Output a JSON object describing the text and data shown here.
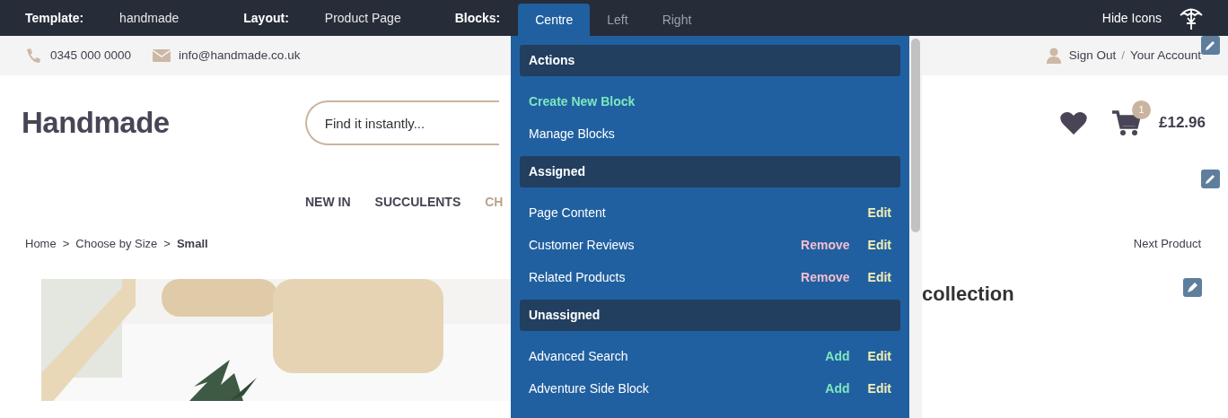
{
  "toolbar": {
    "fields": [
      {
        "label": "Template:",
        "value": "handmade"
      },
      {
        "label": "Layout:",
        "value": "Product Page"
      }
    ],
    "blocks_label": "Blocks:",
    "tabs": [
      {
        "label": "Centre",
        "selected": true
      },
      {
        "label": "Left",
        "selected": false
      },
      {
        "label": "Right",
        "selected": false
      }
    ],
    "hide_icons": "Hide Icons"
  },
  "contact_bar": {
    "phone": "0345 000 0000",
    "email": "info@handmade.co.uk",
    "sign_out": "Sign Out",
    "separator": "/",
    "account": "Your Account"
  },
  "header": {
    "logo": "Handmade",
    "search": {
      "placeholder": "Find it instantly..."
    },
    "cart_count": "1",
    "cart_total": "£12.96"
  },
  "nav": [
    {
      "label": "NEW IN",
      "selected": false
    },
    {
      "label": "SUCCULENTS",
      "selected": false
    },
    {
      "label": "CH",
      "selected": true
    }
  ],
  "breadcrumb": {
    "items": [
      {
        "label": "Home",
        "current": false
      },
      {
        "label": "Choose by Size",
        "current": false
      },
      {
        "label": "Small",
        "current": true
      }
    ],
    "separators": [
      ">",
      ">"
    ]
  },
  "next_product": "Next Product",
  "product_title": "collection",
  "blocks_panel": {
    "sections": [
      {
        "title": "Actions",
        "items": [
          {
            "label": "Create New Block",
            "highlighted": true
          },
          {
            "label": "Manage Blocks",
            "highlighted": false
          }
        ]
      },
      {
        "title": "Assigned",
        "items": [
          {
            "label": "Page Content",
            "highlighted": false,
            "actions": [
              {
                "label": "Edit",
                "kind": "edit"
              }
            ]
          },
          {
            "label": "Customer Reviews",
            "highlighted": false,
            "actions": [
              {
                "label": "Remove",
                "kind": "remove"
              },
              {
                "label": "Edit",
                "kind": "edit"
              }
            ]
          },
          {
            "label": "Related Products",
            "highlighted": false,
            "actions": [
              {
                "label": "Remove",
                "kind": "remove"
              },
              {
                "label": "Edit",
                "kind": "edit"
              }
            ]
          }
        ]
      },
      {
        "title": "Unassigned",
        "items": [
          {
            "label": "Advanced Search",
            "highlighted": false,
            "actions": [
              {
                "label": "Add",
                "kind": "add"
              },
              {
                "label": "Edit",
                "kind": "edit"
              }
            ]
          },
          {
            "label": "Adventure Side Block",
            "highlighted": false,
            "actions": [
              {
                "label": "Add",
                "kind": "add"
              },
              {
                "label": "Edit",
                "kind": "edit"
              }
            ]
          }
        ]
      }
    ]
  }
}
